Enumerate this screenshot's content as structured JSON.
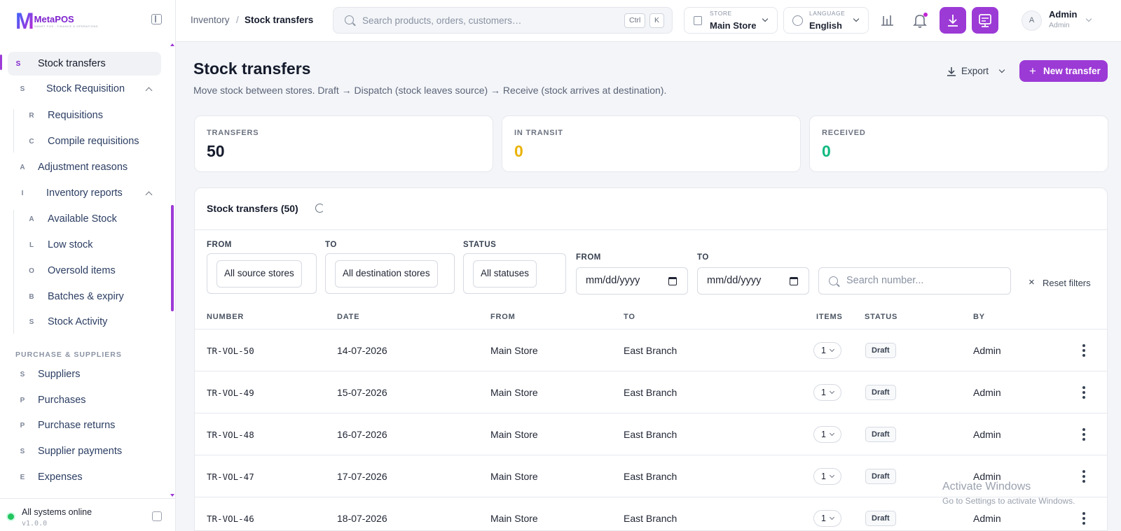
{
  "brand": {
    "logo_letter": "M",
    "name": "MetaPOS",
    "tagline": "SMART POS · FINANCE & OPERATIONS"
  },
  "nav": {
    "items": [
      {
        "letter": "S",
        "label": "Stock transfers"
      },
      {
        "letter": "S",
        "label": "Stock Requisition"
      },
      {
        "letter": "R",
        "label": "Requisitions"
      },
      {
        "letter": "C",
        "label": "Compile requisitions"
      },
      {
        "letter": "A",
        "label": "Adjustment reasons"
      },
      {
        "letter": "I",
        "label": "Inventory reports"
      },
      {
        "letter": "A",
        "label": "Available Stock"
      },
      {
        "letter": "L",
        "label": "Low stock"
      },
      {
        "letter": "O",
        "label": "Oversold items"
      },
      {
        "letter": "B",
        "label": "Batches & expiry"
      },
      {
        "letter": "S",
        "label": "Stock Activity"
      },
      {
        "letter": "S",
        "label": "Suppliers"
      },
      {
        "letter": "P",
        "label": "Purchases"
      },
      {
        "letter": "P",
        "label": "Purchase returns"
      },
      {
        "letter": "S",
        "label": "Supplier payments"
      },
      {
        "letter": "E",
        "label": "Expenses"
      }
    ],
    "section_purchase": "PURCHASE & SUPPLIERS"
  },
  "system": {
    "status": "All systems online",
    "version": "v1.0.0"
  },
  "topbar": {
    "breadcrumb_parent": "Inventory",
    "breadcrumb_sep": "/",
    "breadcrumb_current": "Stock transfers",
    "search_placeholder": "Search products, orders, customers…",
    "kbd_ctrl": "Ctrl",
    "kbd_k": "K",
    "store_label": "STORE",
    "store_value": "Main Store",
    "language_label": "LANGUAGE",
    "language_value": "English",
    "user_initial": "A",
    "user_name": "Admin",
    "user_role": "Admin"
  },
  "page": {
    "title": "Stock transfers",
    "subtitle": "Move stock between stores. Draft → Dispatch (stock leaves source) → Receive (stock arrives at destination).",
    "export_label": "Export",
    "new_label": "New transfer"
  },
  "stats": [
    {
      "label": "TRANSFERS",
      "value": "50",
      "color": "#151b2c"
    },
    {
      "label": "IN TRANSIT",
      "value": "0",
      "color": "#eab308"
    },
    {
      "label": "RECEIVED",
      "value": "0",
      "color": "#10b981"
    }
  ],
  "table": {
    "title": "Stock transfers (50)",
    "filters": {
      "from_label": "FROM",
      "from_value": "All source stores",
      "to_label": "TO",
      "to_value": "All destination stores",
      "status_label": "STATUS",
      "status_value": "All statuses",
      "date_from_label": "FROM",
      "date_from_placeholder": "mm/dd/yyyy",
      "date_to_label": "TO",
      "date_to_placeholder": "mm/dd/yyyy",
      "search_placeholder": "Search number...",
      "reset_label": "Reset filters"
    },
    "columns": [
      "NUMBER",
      "DATE",
      "FROM",
      "TO",
      "ITEMS",
      "STATUS",
      "BY"
    ],
    "rows": [
      {
        "number": "TR-VOL-50",
        "date": "14-07-2026",
        "from": "Main Store",
        "to": "East Branch",
        "items": "1",
        "status": "Draft",
        "by": "Admin"
      },
      {
        "number": "TR-VOL-49",
        "date": "15-07-2026",
        "from": "Main Store",
        "to": "East Branch",
        "items": "1",
        "status": "Draft",
        "by": "Admin"
      },
      {
        "number": "TR-VOL-48",
        "date": "16-07-2026",
        "from": "Main Store",
        "to": "East Branch",
        "items": "1",
        "status": "Draft",
        "by": "Admin"
      },
      {
        "number": "TR-VOL-47",
        "date": "17-07-2026",
        "from": "Main Store",
        "to": "East Branch",
        "items": "1",
        "status": "Draft",
        "by": "Admin"
      },
      {
        "number": "TR-VOL-46",
        "date": "18-07-2026",
        "from": "Main Store",
        "to": "East Branch",
        "items": "1",
        "status": "Draft",
        "by": "Admin"
      }
    ]
  },
  "watermark": {
    "line1": "Activate Windows",
    "line2": "Go to Settings to activate Windows."
  },
  "colors": {
    "accent": "#9c3ad6",
    "in_transit": "#eab308",
    "received": "#10b981",
    "online": "#22c55e"
  }
}
